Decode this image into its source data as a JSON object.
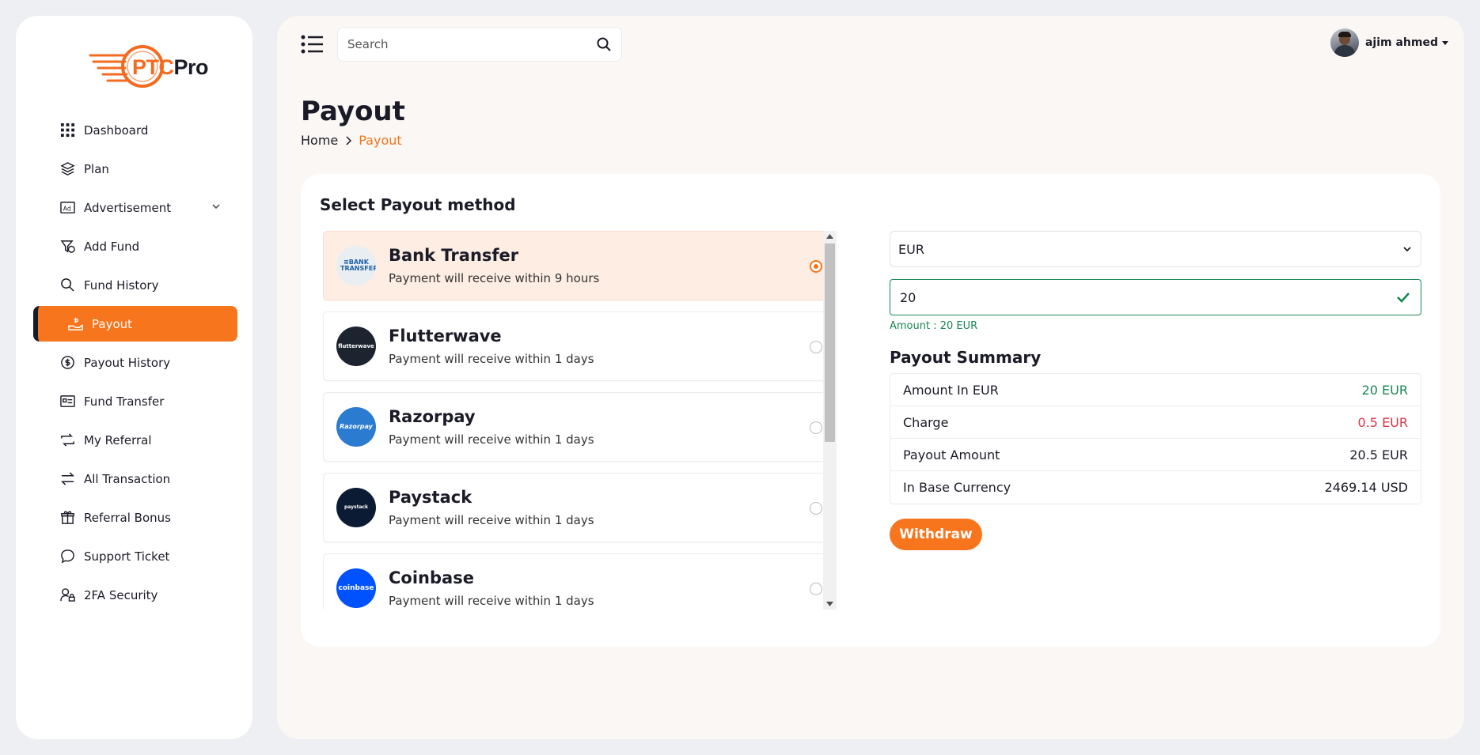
{
  "brand": {
    "logo_ptc": "PTC",
    "logo_pro": "Pro",
    "accent": "#f7751c"
  },
  "sidebar": {
    "items": [
      {
        "label": "Dashboard",
        "icon": "grid-icon"
      },
      {
        "label": "Plan",
        "icon": "layers-icon"
      },
      {
        "label": "Advertisement",
        "icon": "ad-icon"
      },
      {
        "label": "Add Fund",
        "icon": "funnel-dollar-icon"
      },
      {
        "label": "Fund History",
        "icon": "search-dollar-icon"
      },
      {
        "label": "Payout",
        "icon": "hand-dollar-icon"
      },
      {
        "label": "Payout History",
        "icon": "coin-icon"
      },
      {
        "label": "Fund Transfer",
        "icon": "card-list-icon"
      },
      {
        "label": "My Referral",
        "icon": "arrows-cycle-icon"
      },
      {
        "label": "All Transaction",
        "icon": "exchange-icon"
      },
      {
        "label": "Referral Bonus",
        "icon": "gift-icon"
      },
      {
        "label": "Support Ticket",
        "icon": "chat-icon"
      },
      {
        "label": "2FA Security",
        "icon": "user-lock-icon"
      }
    ]
  },
  "header": {
    "search_placeholder": "Search",
    "user_name": "ajim ahmed"
  },
  "page": {
    "title": "Payout",
    "breadcrumb_home": "Home",
    "breadcrumb_current": "Payout"
  },
  "card": {
    "title": "Select Payout method",
    "methods": [
      {
        "name": "Bank Transfer",
        "desc": "Payment will receive within 9 hours",
        "logo": "≡BANK TRANSFER",
        "selected": true
      },
      {
        "name": "Flutterwave",
        "desc": "Payment will receive within 1 days",
        "logo": "flutterwave"
      },
      {
        "name": "Razorpay",
        "desc": "Payment will receive within 1 days",
        "logo": "Razorpay"
      },
      {
        "name": "Paystack",
        "desc": "Payment will receive within 1 days",
        "logo": "paystack"
      },
      {
        "name": "Coinbase",
        "desc": "Payment will receive within 1 days",
        "logo": "coinbase"
      }
    ]
  },
  "form": {
    "currency": "EUR",
    "amount": "20",
    "amount_hint": "Amount : 20 EUR",
    "summary_title": "Payout Summary",
    "summary": [
      {
        "label": "Amount In EUR",
        "value": "20 EUR"
      },
      {
        "label": "Charge",
        "value": "0.5 EUR"
      },
      {
        "label": "Payout Amount",
        "value": "20.5 EUR"
      },
      {
        "label": "In Base Currency",
        "value": "2469.14 USD"
      }
    ],
    "withdraw_label": "Withdraw"
  }
}
